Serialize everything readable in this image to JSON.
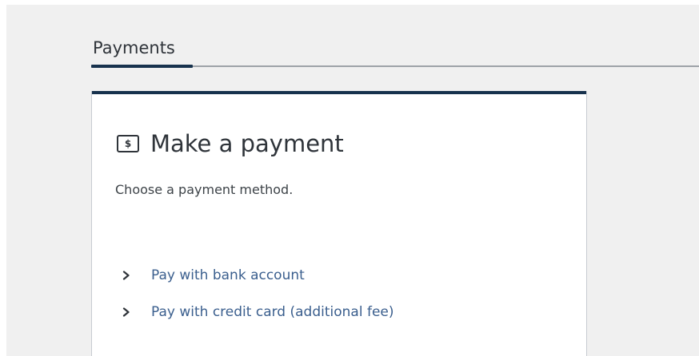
{
  "tabs": {
    "active_label": "Payments"
  },
  "card": {
    "icon": "dollar-bill-icon",
    "icon_glyph": "$",
    "title": "Make a payment",
    "subtitle": "Choose a payment method.",
    "options": [
      {
        "label": "Pay with bank account",
        "icon": "chevron-right-icon"
      },
      {
        "label": "Pay with credit card (additional fee)",
        "icon": "chevron-right-icon"
      }
    ]
  },
  "colors": {
    "accent_navy": "#17324d",
    "link_blue": "#3b5f8e",
    "page_background": "#f0f0f0",
    "text_dark": "#2f343a"
  }
}
